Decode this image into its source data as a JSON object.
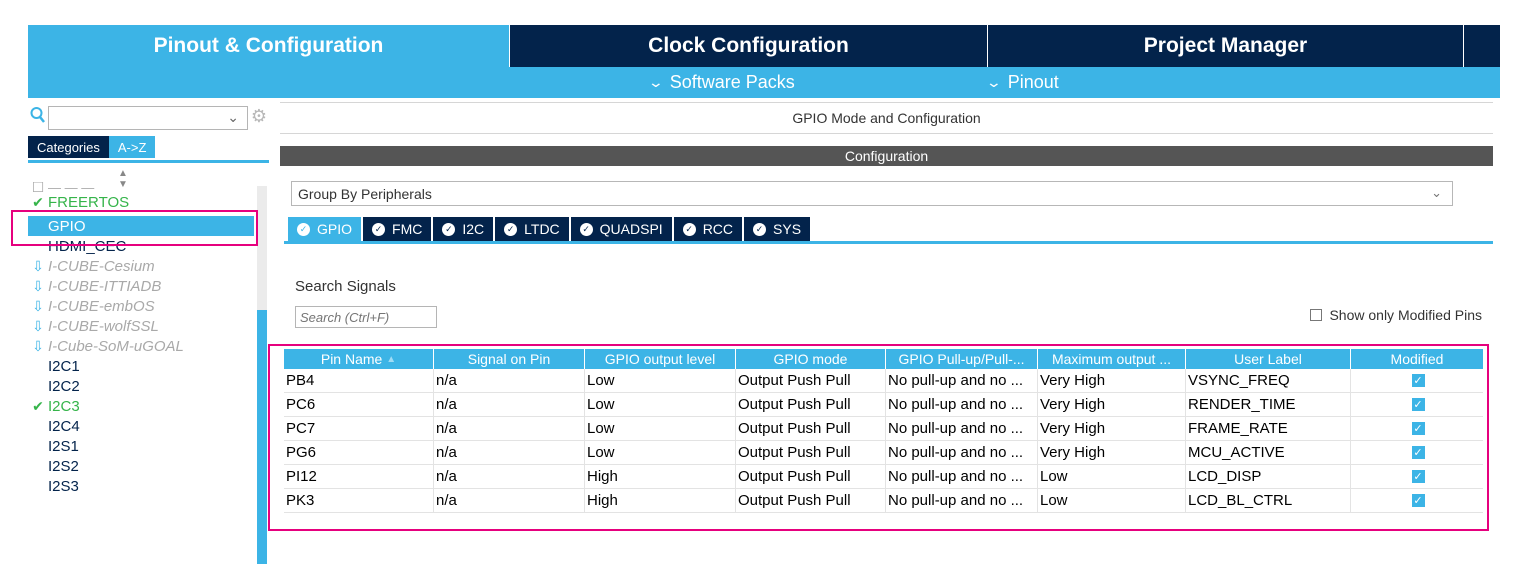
{
  "top_tabs": [
    {
      "label": "Pinout & Configuration",
      "active": true
    },
    {
      "label": "Clock Configuration",
      "active": false
    },
    {
      "label": "Project Manager",
      "active": false
    },
    {
      "label": "",
      "active": false
    }
  ],
  "sub_menu": {
    "software_packs": "Software Packs",
    "pinout": "Pinout",
    "chevron_icon": "chevron-down-icon"
  },
  "left_panel": {
    "search_value": "",
    "categories_tab": "Categories",
    "az_tab": "A->Z",
    "tree_items": [
      {
        "label": "FREERTOS",
        "state": "ok",
        "icon": "check-icon"
      },
      {
        "label": "GPIO",
        "state": "selected",
        "icon": ""
      },
      {
        "label": "HDMI_CEC",
        "state": "normal",
        "icon": ""
      },
      {
        "label": "I-CUBE-Cesium",
        "state": "pack",
        "icon": "download-icon"
      },
      {
        "label": "I-CUBE-ITTIADB",
        "state": "pack",
        "icon": "download-icon"
      },
      {
        "label": "I-CUBE-embOS",
        "state": "pack",
        "icon": "download-icon"
      },
      {
        "label": "I-CUBE-wolfSSL",
        "state": "pack",
        "icon": "download-icon"
      },
      {
        "label": "I-Cube-SoM-uGOAL",
        "state": "pack",
        "icon": "download-icon"
      },
      {
        "label": "I2C1",
        "state": "normal",
        "icon": ""
      },
      {
        "label": "I2C2",
        "state": "normal",
        "icon": ""
      },
      {
        "label": "I2C3",
        "state": "ok",
        "icon": "check-icon"
      },
      {
        "label": "I2C4",
        "state": "normal",
        "icon": ""
      },
      {
        "label": "I2S1",
        "state": "normal",
        "icon": ""
      },
      {
        "label": "I2S2",
        "state": "normal",
        "icon": ""
      },
      {
        "label": "I2S3",
        "state": "normal",
        "icon": ""
      }
    ]
  },
  "main": {
    "mode_title": "GPIO Mode and Configuration",
    "config_title": "Configuration",
    "group_by": "Group By Peripherals",
    "peripheral_tabs": [
      {
        "label": "GPIO",
        "active": true
      },
      {
        "label": "FMC",
        "active": false
      },
      {
        "label": "I2C",
        "active": false
      },
      {
        "label": "LTDC",
        "active": false
      },
      {
        "label": "QUADSPI",
        "active": false
      },
      {
        "label": "RCC",
        "active": false
      },
      {
        "label": "SYS",
        "active": false
      }
    ],
    "search_label": "Search Signals",
    "search_placeholder": "Search (Ctrl+F)",
    "show_modified_label": "Show only Modified Pins",
    "show_modified_checked": false
  },
  "table": {
    "columns": [
      "Pin Name",
      "Signal on Pin",
      "GPIO output level",
      "GPIO mode",
      "GPIO Pull-up/Pull-...",
      "Maximum output ...",
      "User Label",
      "Modified"
    ],
    "sort_icon": "sort-asc-icon",
    "rows": [
      {
        "pin": "PB4",
        "signal": "n/a",
        "level": "Low",
        "mode": "Output Push Pull",
        "pull": "No pull-up and no ...",
        "speed": "Very High",
        "label": "VSYNC_FREQ",
        "modified": true
      },
      {
        "pin": "PC6",
        "signal": "n/a",
        "level": "Low",
        "mode": "Output Push Pull",
        "pull": "No pull-up and no ...",
        "speed": "Very High",
        "label": "RENDER_TIME",
        "modified": true
      },
      {
        "pin": "PC7",
        "signal": "n/a",
        "level": "Low",
        "mode": "Output Push Pull",
        "pull": "No pull-up and no ...",
        "speed": "Very High",
        "label": "FRAME_RATE",
        "modified": true
      },
      {
        "pin": "PG6",
        "signal": "n/a",
        "level": "Low",
        "mode": "Output Push Pull",
        "pull": "No pull-up and no ...",
        "speed": "Very High",
        "label": "MCU_ACTIVE",
        "modified": true
      },
      {
        "pin": "PI12",
        "signal": "n/a",
        "level": "High",
        "mode": "Output Push Pull",
        "pull": "No pull-up and no ...",
        "speed": "Low",
        "label": "LCD_DISP",
        "modified": true
      },
      {
        "pin": "PK3",
        "signal": "n/a",
        "level": "High",
        "mode": "Output Push Pull",
        "pull": "No pull-up and no ...",
        "speed": "Low",
        "label": "LCD_BL_CTRL",
        "modified": true
      }
    ]
  },
  "colors": {
    "accent": "#3cb4e6",
    "dark_navy": "#03234b",
    "highlight_annotation": "#e6007e",
    "ok_green": "#35b44a"
  }
}
